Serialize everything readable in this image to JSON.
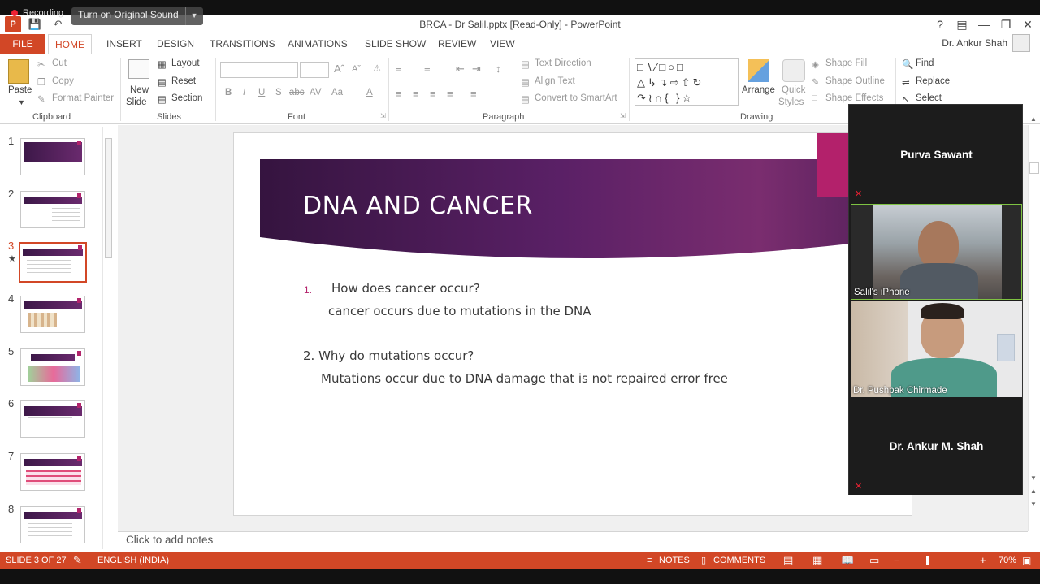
{
  "overlay": {
    "recording_label": "Recording",
    "sound_button": "Turn on Original Sound"
  },
  "window": {
    "title": "BRCA - Dr Salil.pptx [Read-Only] - PowerPoint",
    "help": "?",
    "user": "Dr. Ankur Shah"
  },
  "tabs": [
    "FILE",
    "HOME",
    "INSERT",
    "DESIGN",
    "TRANSITIONS",
    "ANIMATIONS",
    "SLIDE SHOW",
    "REVIEW",
    "VIEW"
  ],
  "ribbon": {
    "clipboard": {
      "label": "Clipboard",
      "paste": "Paste",
      "cut": "Cut",
      "copy": "Copy",
      "format_painter": "Format Painter"
    },
    "slides": {
      "label": "Slides",
      "new_slide_line1": "New",
      "new_slide_line2": "Slide",
      "layout": "Layout",
      "reset": "Reset",
      "section": "Section"
    },
    "font": {
      "label": "Font",
      "bold": "B",
      "italic": "I",
      "underline": "U",
      "shadow": "S",
      "strike": "abc",
      "spacing": "AV",
      "case": "Aa",
      "color": "A"
    },
    "paragraph": {
      "label": "Paragraph",
      "text_direction": "Text Direction",
      "align_text": "Align Text",
      "convert_smartart": "Convert to SmartArt"
    },
    "drawing": {
      "label": "Drawing",
      "arrange": "Arrange",
      "quick_styles_line1": "Quick",
      "quick_styles_line2": "Styles",
      "shape_fill": "Shape Fill",
      "shape_outline": "Shape Outline",
      "shape_effects": "Shape Effects"
    },
    "editing": {
      "find": "Find",
      "replace": "Replace",
      "select": "Select"
    }
  },
  "thumbnails": [
    "1",
    "2",
    "3",
    "4",
    "5",
    "6",
    "7",
    "8"
  ],
  "slide": {
    "title": "DNA AND CANCER",
    "item1_num": "1.",
    "item1": "How does cancer occur?",
    "item1_answer": "cancer occurs due to mutations in the DNA",
    "item2": "2. Why do mutations occur?",
    "item2_answer": "Mutations occur due to DNA damage that is not repaired error free"
  },
  "notes_placeholder": "Click to add notes",
  "participants": [
    {
      "name": "Purva Sawant"
    },
    {
      "name": "Salil's iPhone"
    },
    {
      "name": "Dr. Pushpak Chirmade"
    },
    {
      "name": "Dr. Ankur M. Shah"
    }
  ],
  "status": {
    "slide": "SLIDE 3 OF 27",
    "language": "ENGLISH (INDIA)",
    "notes": "NOTES",
    "comments": "COMMENTS",
    "zoom": "70%"
  }
}
